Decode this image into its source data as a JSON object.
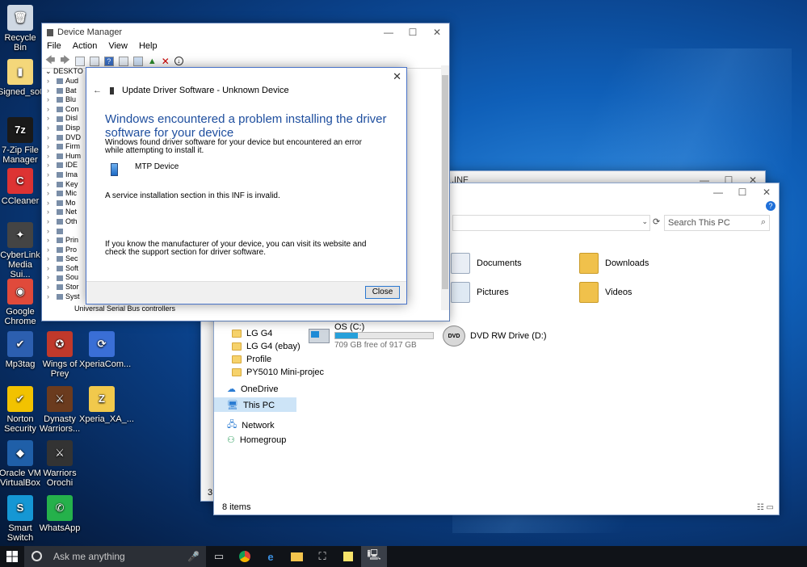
{
  "desktop": {
    "icons": [
      {
        "label": "Recycle Bin",
        "glyph": "🗑",
        "color": "#cfd8e3"
      },
      {
        "label": "Signed_so0...",
        "glyph": "▮",
        "color": "#f4d77a"
      },
      {
        "label": "7-Zip File Manager",
        "glyph": "7z",
        "color": "#1a1a1a"
      },
      {
        "label": "CCleaner",
        "glyph": "C",
        "color": "#d33"
      },
      {
        "label": "CyberLink Media Sui...",
        "glyph": "✦",
        "color": "#444"
      },
      {
        "label": "Google Chrome",
        "glyph": "◉",
        "color": "#e04a3b"
      },
      {
        "label": "Mp3tag",
        "glyph": "✔",
        "color": "#2c5fb0"
      },
      {
        "label": "Wings of Prey",
        "glyph": "✪",
        "color": "#c0392b"
      },
      {
        "label": "XperiaCom...",
        "glyph": "⟳",
        "color": "#3a6fd6"
      },
      {
        "label": "Norton Security",
        "glyph": "✔",
        "color": "#f2c200"
      },
      {
        "label": "Dynasty Warriors...",
        "glyph": "⚔",
        "color": "#6b3b1e"
      },
      {
        "label": "Xperia_XA_...",
        "glyph": "Z",
        "color": "#f1c94c"
      },
      {
        "label": "Oracle VM VirtualBox",
        "glyph": "◆",
        "color": "#1f5fa8"
      },
      {
        "label": "Warriors Orochi",
        "glyph": "⚔",
        "color": "#333"
      },
      {
        "label": "Smart Switch",
        "glyph": "S",
        "color": "#1597d4"
      },
      {
        "label": "WhatsApp",
        "glyph": "✆",
        "color": "#25b14b"
      }
    ]
  },
  "explorer_back": {
    "title": ".INF"
  },
  "explorer": {
    "search_placeholder": "Search This PC",
    "nav_items": [
      {
        "label": "LG G4"
      },
      {
        "label": "LG G4 (ebay)"
      },
      {
        "label": "Profile"
      },
      {
        "label": "PY5010 Mini-projec"
      }
    ],
    "nav_cloud": "OneDrive",
    "nav_thispc": "This PC",
    "nav_network": "Network",
    "nav_homegroup": "Homegroup",
    "folders": [
      "Documents",
      "Downloads",
      "Pictures",
      "Videos"
    ],
    "drive_c": {
      "name": "OS (C:)",
      "free": "709 GB free of 917 GB",
      "used_fraction": 0.23
    },
    "drive_d": {
      "name": "DVD RW Drive (D:)"
    },
    "status": "8 items",
    "status_back": "3 i"
  },
  "devmgr": {
    "title": "Device Manager",
    "menu": [
      "File",
      "Action",
      "View",
      "Help"
    ],
    "root": "DESKTO",
    "tree": [
      "Aud",
      "Bat",
      "Blu",
      "Con",
      "Disl",
      "Disp",
      "DVD",
      "Firm",
      "Hum",
      "IDE",
      "Ima",
      "Key",
      "Mic",
      "Mo",
      "Net",
      "Oth",
      "",
      "Prin",
      "Pro",
      "Sec",
      "Soft",
      "Sou",
      "Stor",
      "Syst"
    ],
    "bottom_item": "Universal Serial Bus controllers"
  },
  "dialog": {
    "header": "Update Driver Software - Unknown Device",
    "title": "Windows encountered a problem installing the driver software for your device",
    "para1": "Windows found driver software for your device but encountered an error while attempting to install it.",
    "device": "MTP Device",
    "error": "A service installation section in this INF is invalid.",
    "para2": "If you know the manufacturer of your device, you can visit its website and check the support section for driver software.",
    "close_label": "Close"
  },
  "taskbar": {
    "search_placeholder": "Ask me anything"
  }
}
